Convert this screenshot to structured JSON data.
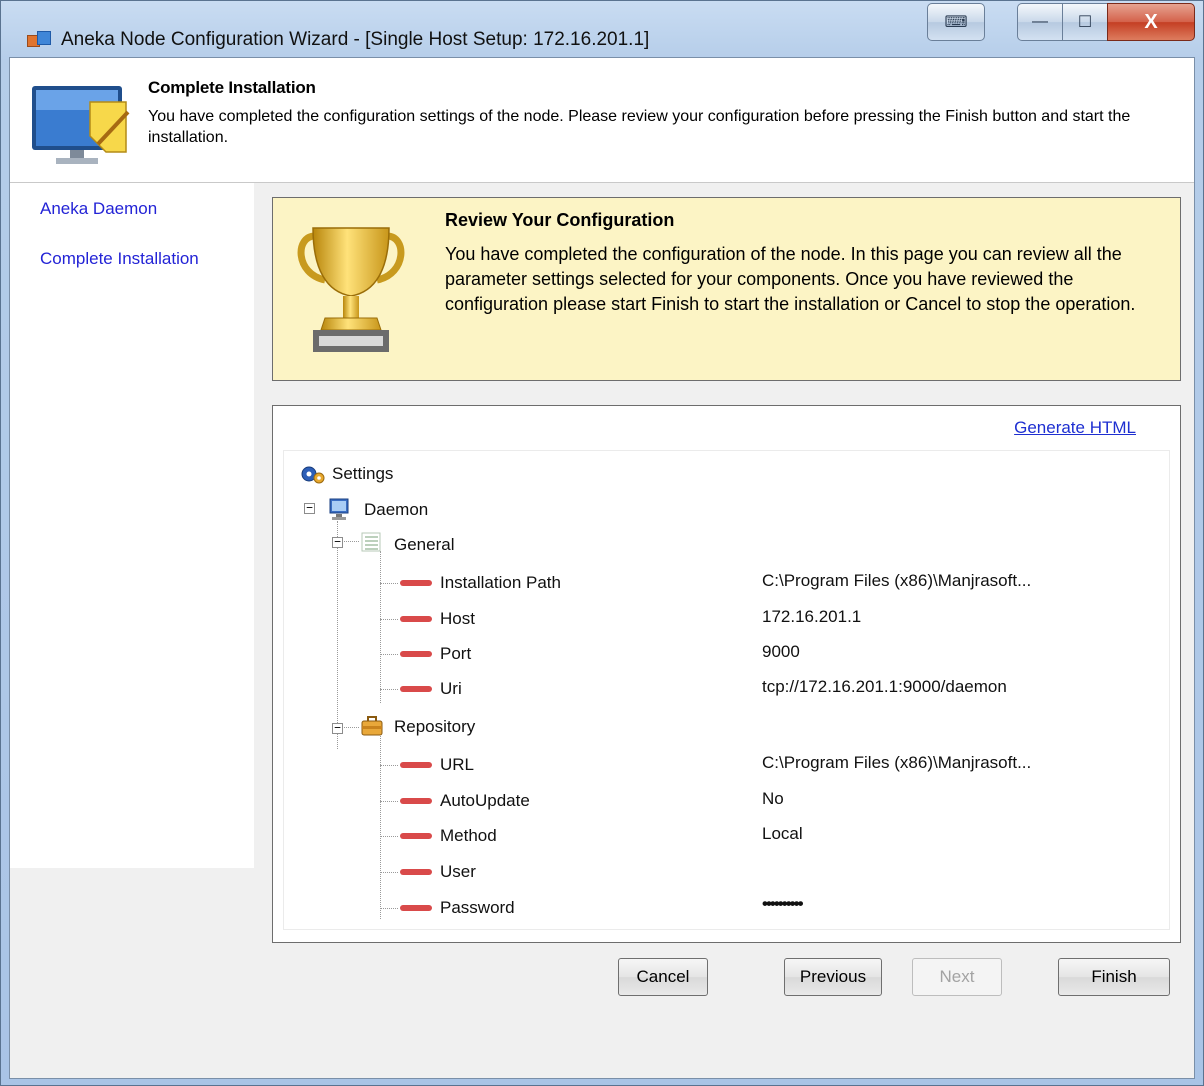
{
  "window": {
    "title": "Aneka Node Configuration Wizard - [Single Host Setup: 172.16.201.1]",
    "close_glyph": "X",
    "keyboard_glyph": "⌨",
    "minimize_glyph": "—",
    "maximize_glyph": "☐"
  },
  "header": {
    "title": "Complete Installation",
    "description": "You have completed the configuration settings of the node. Please review your configuration before pressing the Finish button and start the installation."
  },
  "sidebar": {
    "items": [
      {
        "label": "Aneka Daemon"
      },
      {
        "label": "Complete Installation"
      }
    ]
  },
  "review": {
    "title": "Review Your Configuration",
    "text": "You have completed the configuration of the node. In this page you can review all the parameter settings selected for your components. Once you have reviewed the configuration please start Finish to start the installation or Cancel to stop the operation."
  },
  "settings": {
    "generate_link": "Generate HTML",
    "root": "Settings",
    "daemon": "Daemon",
    "general": {
      "label": "General",
      "items": [
        {
          "key": "Installation Path",
          "value": "C:\\Program Files (x86)\\Manjrasoft..."
        },
        {
          "key": "Host",
          "value": "172.16.201.1"
        },
        {
          "key": "Port",
          "value": "9000"
        },
        {
          "key": "Uri",
          "value": "tcp://172.16.201.1:9000/daemon"
        }
      ]
    },
    "repository": {
      "label": "Repository",
      "items": [
        {
          "key": "URL",
          "value": "C:\\Program Files (x86)\\Manjrasoft..."
        },
        {
          "key": "AutoUpdate",
          "value": "No"
        },
        {
          "key": "Method",
          "value": "Local"
        },
        {
          "key": "User",
          "value": ""
        },
        {
          "key": "Password",
          "value": "••••••••••"
        }
      ]
    }
  },
  "buttons": {
    "cancel": "Cancel",
    "previous": "Previous",
    "next": "Next",
    "finish": "Finish"
  },
  "colors": {
    "accent_link": "#2323d6",
    "review_bg": "#fcf4c5",
    "property_marker": "#d94a4a"
  }
}
